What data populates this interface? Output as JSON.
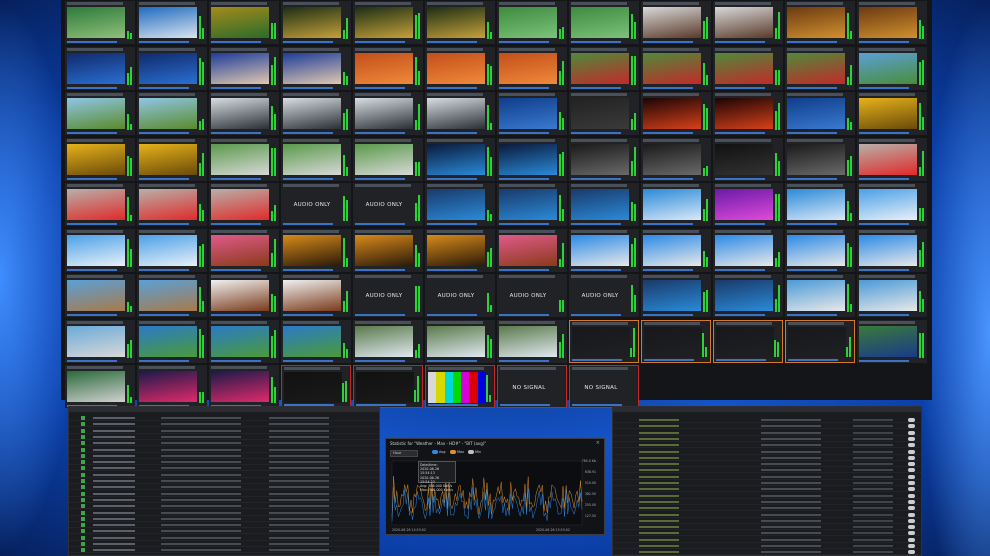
{
  "wall": {
    "tiles": [
      {
        "kind": "video",
        "colors": [
          "#2e7a3b",
          "#8fc07a"
        ]
      },
      {
        "kind": "video",
        "colors": [
          "#1e6bc0",
          "#d9e3ee"
        ]
      },
      {
        "kind": "video",
        "colors": [
          "#a58a1b",
          "#2a6c2a"
        ]
      },
      {
        "kind": "video",
        "colors": [
          "#1c2e15",
          "#c4a13a"
        ]
      },
      {
        "kind": "video",
        "colors": [
          "#1c2e15",
          "#c4a13a"
        ]
      },
      {
        "kind": "video",
        "colors": [
          "#1c2e15",
          "#c4a13a"
        ]
      },
      {
        "kind": "video",
        "colors": [
          "#3d8b3d",
          "#7cc27c"
        ]
      },
      {
        "kind": "video",
        "colors": [
          "#3d8b3d",
          "#7cc27c"
        ]
      },
      {
        "kind": "video",
        "colors": [
          "#d8d8d8",
          "#5a3a2a"
        ]
      },
      {
        "kind": "video",
        "colors": [
          "#d8d8d8",
          "#5a3a2a"
        ]
      },
      {
        "kind": "video",
        "colors": [
          "#6b3a12",
          "#d1902e"
        ]
      },
      {
        "kind": "video",
        "colors": [
          "#6b3a12",
          "#d1902e"
        ]
      },
      {
        "kind": "video",
        "colors": [
          "#0f2a6a",
          "#2b6fd3"
        ]
      },
      {
        "kind": "video",
        "colors": [
          "#0f2a6a",
          "#2b6fd3"
        ]
      },
      {
        "kind": "video",
        "colors": [
          "#1c3c9a",
          "#e0c8b0"
        ]
      },
      {
        "kind": "video",
        "colors": [
          "#1c3c9a",
          "#e0c8b0"
        ]
      },
      {
        "kind": "video",
        "colors": [
          "#c24e1a",
          "#f08a3a"
        ]
      },
      {
        "kind": "video",
        "colors": [
          "#c24e1a",
          "#f08a3a"
        ]
      },
      {
        "kind": "video",
        "colors": [
          "#c24e1a",
          "#f08a3a"
        ]
      },
      {
        "kind": "video",
        "colors": [
          "#4f8a3a",
          "#c12a2a"
        ]
      },
      {
        "kind": "video",
        "colors": [
          "#4f8a3a",
          "#c12a2a"
        ]
      },
      {
        "kind": "video",
        "colors": [
          "#4f8a3a",
          "#c12a2a"
        ]
      },
      {
        "kind": "video",
        "colors": [
          "#4f8a3a",
          "#c12a2a"
        ]
      },
      {
        "kind": "video",
        "colors": [
          "#5aa0d8",
          "#4a8c3a"
        ]
      },
      {
        "kind": "video",
        "colors": [
          "#8fc6e6",
          "#5a8a2a"
        ]
      },
      {
        "kind": "video",
        "colors": [
          "#8fc6e6",
          "#5a8a2a"
        ]
      },
      {
        "kind": "video",
        "colors": [
          "#d8dde2",
          "#2a2f35"
        ]
      },
      {
        "kind": "video",
        "colors": [
          "#d8dde2",
          "#2a2f35"
        ]
      },
      {
        "kind": "video",
        "colors": [
          "#d8dde2",
          "#2a2f35"
        ]
      },
      {
        "kind": "video",
        "colors": [
          "#d8dde2",
          "#2a2f35"
        ]
      },
      {
        "kind": "video",
        "colors": [
          "#0f3d8a",
          "#3a7ad0"
        ]
      },
      {
        "kind": "video",
        "colors": [
          "#222",
          "#3a3a3a"
        ]
      },
      {
        "kind": "video",
        "colors": [
          "#1a0505",
          "#d8401a"
        ]
      },
      {
        "kind": "video",
        "colors": [
          "#1a0505",
          "#d8401a"
        ]
      },
      {
        "kind": "video",
        "colors": [
          "#0f3d8a",
          "#3a7ad0"
        ]
      },
      {
        "kind": "video",
        "colors": [
          "#e6b21a",
          "#6a4a0a"
        ]
      },
      {
        "kind": "video",
        "colors": [
          "#e6b21a",
          "#6a4a0a"
        ]
      },
      {
        "kind": "video",
        "colors": [
          "#e6b21a",
          "#6a4a0a"
        ]
      },
      {
        "kind": "video",
        "colors": [
          "#5a9a4a",
          "#d8d8d8"
        ]
      },
      {
        "kind": "video",
        "colors": [
          "#5a9a4a",
          "#d8d8d8"
        ]
      },
      {
        "kind": "video",
        "colors": [
          "#5a9a4a",
          "#d8d8d8"
        ]
      },
      {
        "kind": "video",
        "colors": [
          "#0a1a3a",
          "#2a8ad8"
        ]
      },
      {
        "kind": "video",
        "colors": [
          "#0a1a3a",
          "#2a8ad8"
        ]
      },
      {
        "kind": "video",
        "colors": [
          "#1a1a1a",
          "#6a6a6a"
        ]
      },
      {
        "kind": "video",
        "colors": [
          "#1a1a1a",
          "#6a6a6a"
        ]
      },
      {
        "kind": "video",
        "colors": [
          "#111",
          "#333"
        ]
      },
      {
        "kind": "video",
        "colors": [
          "#1a1a1a",
          "#6a6a6a"
        ]
      },
      {
        "kind": "video",
        "colors": [
          "#b8b0a8",
          "#e02a2a"
        ]
      },
      {
        "kind": "video",
        "colors": [
          "#b8b0a8",
          "#e02a2a"
        ]
      },
      {
        "kind": "video",
        "colors": [
          "#b8b0a8",
          "#e02a2a"
        ]
      },
      {
        "kind": "video",
        "colors": [
          "#b8b0a8",
          "#e02a2a"
        ]
      },
      {
        "kind": "text",
        "text": "AUDIO ONLY"
      },
      {
        "kind": "text",
        "text": "AUDIO ONLY"
      },
      {
        "kind": "video",
        "colors": [
          "#1a3a6a",
          "#2a8ad8"
        ]
      },
      {
        "kind": "video",
        "colors": [
          "#1a3a6a",
          "#2a8ad8"
        ]
      },
      {
        "kind": "video",
        "colors": [
          "#1a3a6a",
          "#2a8ad8"
        ]
      },
      {
        "kind": "video",
        "colors": [
          "#2a8ad8",
          "#d8e8f8"
        ]
      },
      {
        "kind": "video",
        "colors": [
          "#6a1aa8",
          "#e04ad8"
        ]
      },
      {
        "kind": "video",
        "colors": [
          "#2a8ad8",
          "#d8e8f8"
        ]
      },
      {
        "kind": "video",
        "colors": [
          "#4aa0e8",
          "#e8f0f8"
        ]
      },
      {
        "kind": "video",
        "colors": [
          "#4aa0e8",
          "#e8f0f8"
        ]
      },
      {
        "kind": "video",
        "colors": [
          "#4aa0e8",
          "#e8f0f8"
        ]
      },
      {
        "kind": "video",
        "colors": [
          "#e05a8a",
          "#8a3a1a"
        ]
      },
      {
        "kind": "video",
        "colors": [
          "#d88a1a",
          "#2a1a0a"
        ]
      },
      {
        "kind": "video",
        "colors": [
          "#d88a1a",
          "#2a1a0a"
        ]
      },
      {
        "kind": "video",
        "colors": [
          "#d88a1a",
          "#2a1a0a"
        ]
      },
      {
        "kind": "video",
        "colors": [
          "#e05a8a",
          "#8a3a1a"
        ]
      },
      {
        "kind": "video",
        "colors": [
          "#2a8ae8",
          "#e8e8e8"
        ]
      },
      {
        "kind": "video",
        "colors": [
          "#2a8ae8",
          "#e8e8e8"
        ]
      },
      {
        "kind": "video",
        "colors": [
          "#2a8ae8",
          "#e8e8e8"
        ]
      },
      {
        "kind": "video",
        "colors": [
          "#2a8ae8",
          "#e8e8e8"
        ]
      },
      {
        "kind": "video",
        "colors": [
          "#2a8ae8",
          "#e8e8e8"
        ]
      },
      {
        "kind": "video",
        "colors": [
          "#5aa0d8",
          "#a87a4a"
        ]
      },
      {
        "kind": "video",
        "colors": [
          "#5aa0d8",
          "#a87a4a"
        ]
      },
      {
        "kind": "video",
        "colors": [
          "#f0f0f0",
          "#7a3a1a"
        ]
      },
      {
        "kind": "video",
        "colors": [
          "#f0f0f0",
          "#7a3a1a"
        ]
      },
      {
        "kind": "text",
        "text": "AUDIO ONLY"
      },
      {
        "kind": "text",
        "text": "AUDIO ONLY"
      },
      {
        "kind": "text",
        "text": "AUDIO ONLY"
      },
      {
        "kind": "text",
        "text": "AUDIO ONLY"
      },
      {
        "kind": "video",
        "colors": [
          "#1a3a6a",
          "#2a8ad8"
        ]
      },
      {
        "kind": "video",
        "colors": [
          "#1a3a6a",
          "#2a8ad8"
        ]
      },
      {
        "kind": "video",
        "colors": [
          "#4a9ad8",
          "#e8e8e8"
        ]
      },
      {
        "kind": "video",
        "colors": [
          "#4a9ad8",
          "#e8e8e8"
        ]
      },
      {
        "kind": "video",
        "colors": [
          "#6aaad8",
          "#d8d8d8"
        ]
      },
      {
        "kind": "video",
        "colors": [
          "#2a7ac8",
          "#4a9a3a"
        ]
      },
      {
        "kind": "video",
        "colors": [
          "#2a7ac8",
          "#4a9a3a"
        ]
      },
      {
        "kind": "video",
        "colors": [
          "#2a7ac8",
          "#4a9a3a"
        ]
      },
      {
        "kind": "video",
        "colors": [
          "#5a7a4a",
          "#e0e8f0"
        ]
      },
      {
        "kind": "video",
        "colors": [
          "#5a7a4a",
          "#e0e8f0"
        ]
      },
      {
        "kind": "video",
        "colors": [
          "#5a7a4a",
          "#e0e8f0"
        ]
      },
      {
        "kind": "video",
        "colors": [
          "#16181b",
          "#1e2024"
        ],
        "border": "orange"
      },
      {
        "kind": "video",
        "colors": [
          "#16181b",
          "#1e2024"
        ],
        "border": "orange"
      },
      {
        "kind": "video",
        "colors": [
          "#16181b",
          "#1e2024"
        ],
        "border": "orange"
      },
      {
        "kind": "video",
        "colors": [
          "#16181b",
          "#1e2024"
        ],
        "border": "orange"
      },
      {
        "kind": "video",
        "colors": [
          "#3a7a3a",
          "#1a3a8a"
        ]
      },
      {
        "kind": "video",
        "colors": [
          "#2a6a3a",
          "#d0d0d0"
        ]
      },
      {
        "kind": "video",
        "colors": [
          "#1a1a4a",
          "#e02a6a"
        ]
      },
      {
        "kind": "video",
        "colors": [
          "#1a1a4a",
          "#e02a6a"
        ]
      },
      {
        "kind": "video",
        "colors": [
          "#111",
          "#1a1a1a"
        ],
        "border": "red"
      },
      {
        "kind": "video",
        "colors": [
          "#111",
          "#1a1a1a"
        ],
        "border": "red"
      },
      {
        "kind": "bars",
        "border": "red"
      },
      {
        "kind": "text",
        "text": "NO SIGNAL",
        "border": "red"
      },
      {
        "kind": "text",
        "text": "NO SIGNAL",
        "border": "red"
      }
    ],
    "bar_colors": [
      "#d8d8d8",
      "#d8d800",
      "#00d8d8",
      "#00d800",
      "#d800d8",
      "#d80000",
      "#0000d8"
    ]
  },
  "stats": {
    "title": "Statistic for \"Weather - Max - HD#\" - \"BIT (avg)\"",
    "close": "×",
    "select": "Hour",
    "legend": [
      "Avg",
      "Max",
      "Min"
    ],
    "tooltip": [
      "Date/time:",
      "2020-06-26 15:54:13",
      "2020-06-26 15:54:23",
      "Avg: 566.000 Kbit/s",
      "Max: 566.000 Kbit/s"
    ],
    "y_ticks": [
      "765.0 Kb",
      "638.91",
      "510.00",
      "382.50",
      "255.00",
      "127.50"
    ],
    "x_ticks": [
      "2020-06-26 14:53:02",
      "2020-06-26 15:53:02"
    ]
  }
}
